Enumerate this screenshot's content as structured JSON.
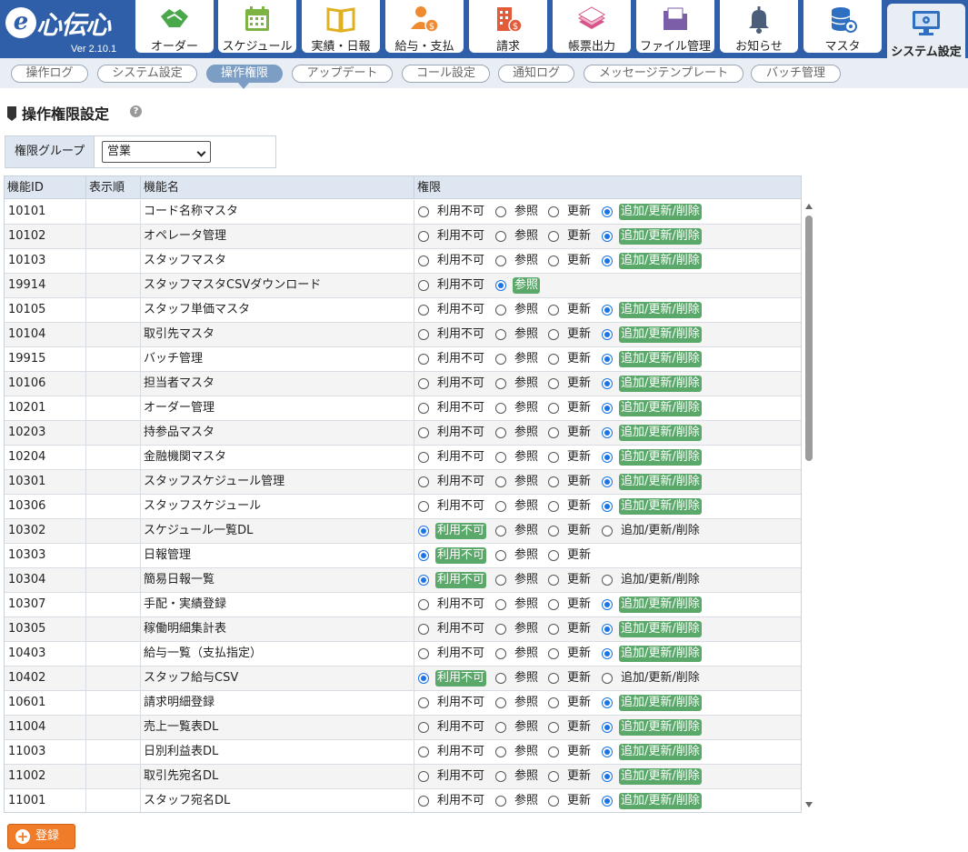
{
  "app": {
    "logo_mark": "e",
    "logo_text": "心伝心",
    "version": "Ver 2.10.1"
  },
  "nav": [
    {
      "label": "オーダー",
      "icon": "handshake-icon",
      "color": "#4aa84a"
    },
    {
      "label": "スケジュール",
      "icon": "calendar-icon",
      "color": "#7cb342"
    },
    {
      "label": "実績・日報",
      "icon": "book-icon",
      "color": "#e0b020"
    },
    {
      "label": "給与・支払",
      "icon": "person-money-icon",
      "color": "#f08a30"
    },
    {
      "label": "請求",
      "icon": "building-money-icon",
      "color": "#e25b3a"
    },
    {
      "label": "帳票出力",
      "icon": "papers-icon",
      "color": "#d6558a"
    },
    {
      "label": "ファイル管理",
      "icon": "folder-icon",
      "color": "#7b5ea7"
    },
    {
      "label": "お知らせ",
      "icon": "bell-icon",
      "color": "#4a5d79"
    },
    {
      "label": "マスタ",
      "icon": "database-icon",
      "color": "#2f6fc2"
    },
    {
      "label": "システム設定",
      "icon": "monitor-gear-icon",
      "color": "#2f6fc2"
    }
  ],
  "subnav": [
    "操作ログ",
    "システム設定",
    "操作権限",
    "アップデート",
    "コール設定",
    "通知ログ",
    "メッセージテンプレート",
    "バッチ管理"
  ],
  "page_title": "操作権限設定",
  "help_glyph": "?",
  "group": {
    "label": "権限グループ",
    "value": "営業"
  },
  "table": {
    "headers": [
      "機能ID",
      "表示順",
      "機能名",
      "権限"
    ],
    "option_labels": [
      "利用不可",
      "参照",
      "更新",
      "追加/更新/削除"
    ],
    "rows": [
      {
        "id": "10101",
        "order": "",
        "name": "コード名称マスタ",
        "options": 4,
        "selected": 3
      },
      {
        "id": "10102",
        "order": "",
        "name": "オペレータ管理",
        "options": 4,
        "selected": 3
      },
      {
        "id": "10103",
        "order": "",
        "name": "スタッフマスタ",
        "options": 4,
        "selected": 3
      },
      {
        "id": "19914",
        "order": "",
        "name": "スタッフマスタCSVダウンロード",
        "options": 2,
        "selected": 1
      },
      {
        "id": "10105",
        "order": "",
        "name": "スタッフ単価マスタ",
        "options": 4,
        "selected": 3
      },
      {
        "id": "10104",
        "order": "",
        "name": "取引先マスタ",
        "options": 4,
        "selected": 3
      },
      {
        "id": "19915",
        "order": "",
        "name": "バッチ管理",
        "options": 4,
        "selected": 3
      },
      {
        "id": "10106",
        "order": "",
        "name": "担当者マスタ",
        "options": 4,
        "selected": 3
      },
      {
        "id": "10201",
        "order": "",
        "name": "オーダー管理",
        "options": 4,
        "selected": 3
      },
      {
        "id": "10203",
        "order": "",
        "name": "持参品マスタ",
        "options": 4,
        "selected": 3
      },
      {
        "id": "10204",
        "order": "",
        "name": "金融機関マスタ",
        "options": 4,
        "selected": 3
      },
      {
        "id": "10301",
        "order": "",
        "name": "スタッフスケジュール管理",
        "options": 4,
        "selected": 3
      },
      {
        "id": "10306",
        "order": "",
        "name": "スタッフスケジュール",
        "options": 4,
        "selected": 3
      },
      {
        "id": "10302",
        "order": "",
        "name": "スケジュール一覧DL",
        "options": 4,
        "selected": 0
      },
      {
        "id": "10303",
        "order": "",
        "name": "日報管理",
        "options": 3,
        "selected": 0
      },
      {
        "id": "10304",
        "order": "",
        "name": "簡易日報一覧",
        "options": 4,
        "selected": 0
      },
      {
        "id": "10307",
        "order": "",
        "name": "手配・実績登録",
        "options": 4,
        "selected": 3
      },
      {
        "id": "10305",
        "order": "",
        "name": "稼働明細集計表",
        "options": 4,
        "selected": 3
      },
      {
        "id": "10403",
        "order": "",
        "name": "給与一覧（支払指定）",
        "options": 4,
        "selected": 3
      },
      {
        "id": "10402",
        "order": "",
        "name": "スタッフ給与CSV",
        "options": 4,
        "selected": 0
      },
      {
        "id": "10601",
        "order": "",
        "name": "請求明細登録",
        "options": 4,
        "selected": 3
      },
      {
        "id": "11004",
        "order": "",
        "name": "売上一覧表DL",
        "options": 4,
        "selected": 3
      },
      {
        "id": "11003",
        "order": "",
        "name": "日別利益表DL",
        "options": 4,
        "selected": 3
      },
      {
        "id": "11002",
        "order": "",
        "name": "取引先宛名DL",
        "options": 4,
        "selected": 3
      },
      {
        "id": "11001",
        "order": "",
        "name": "スタッフ宛名DL",
        "options": 4,
        "selected": 3
      }
    ]
  },
  "register_button": {
    "label": "登録",
    "glyph": "+"
  }
}
